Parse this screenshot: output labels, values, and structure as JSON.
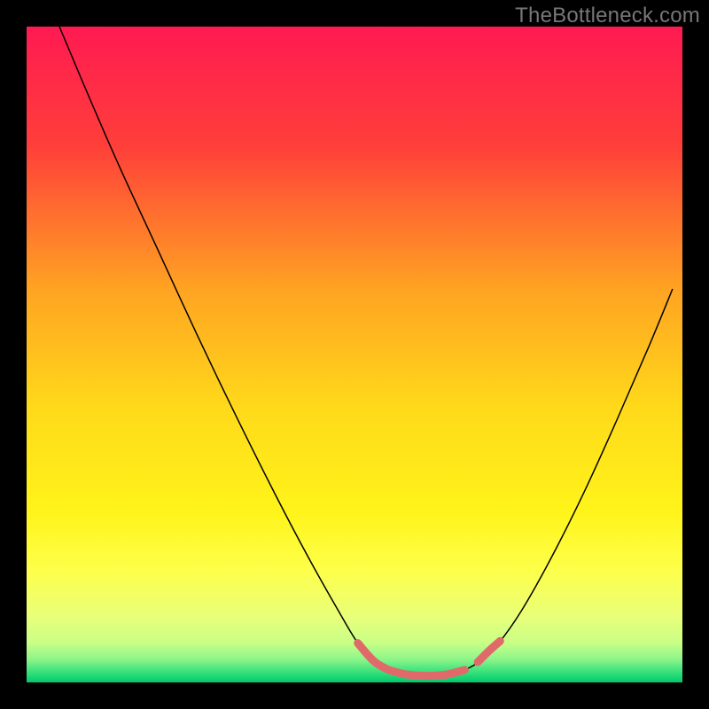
{
  "watermark": "TheBottleneck.com",
  "chart_data": {
    "type": "line",
    "title": "",
    "xlabel": "",
    "ylabel": "",
    "xlim": [
      0,
      1
    ],
    "ylim": [
      0,
      1
    ],
    "background_gradient": {
      "stops": [
        {
          "offset": 0.0,
          "color": "#ff1a52"
        },
        {
          "offset": 0.18,
          "color": "#ff3e3a"
        },
        {
          "offset": 0.4,
          "color": "#ffa322"
        },
        {
          "offset": 0.58,
          "color": "#ffd91a"
        },
        {
          "offset": 0.74,
          "color": "#fff41a"
        },
        {
          "offset": 0.83,
          "color": "#fdff4a"
        },
        {
          "offset": 0.9,
          "color": "#e9ff7a"
        },
        {
          "offset": 0.94,
          "color": "#c8ff86"
        },
        {
          "offset": 0.965,
          "color": "#8cf58a"
        },
        {
          "offset": 0.985,
          "color": "#34e07a"
        },
        {
          "offset": 1.0,
          "color": "#00c96e"
        }
      ]
    },
    "series": [
      {
        "name": "bottleneck-curve",
        "stroke": "#000000",
        "stroke_width": 1.5,
        "points": [
          {
            "x": 0.05,
            "y": 1.0
          },
          {
            "x": 0.09,
            "y": 0.905
          },
          {
            "x": 0.14,
            "y": 0.79
          },
          {
            "x": 0.2,
            "y": 0.66
          },
          {
            "x": 0.26,
            "y": 0.53
          },
          {
            "x": 0.32,
            "y": 0.405
          },
          {
            "x": 0.38,
            "y": 0.285
          },
          {
            "x": 0.43,
            "y": 0.19
          },
          {
            "x": 0.475,
            "y": 0.11
          },
          {
            "x": 0.505,
            "y": 0.06
          },
          {
            "x": 0.53,
            "y": 0.032
          },
          {
            "x": 0.555,
            "y": 0.018
          },
          {
            "x": 0.58,
            "y": 0.012
          },
          {
            "x": 0.61,
            "y": 0.01
          },
          {
            "x": 0.64,
            "y": 0.012
          },
          {
            "x": 0.67,
            "y": 0.02
          },
          {
            "x": 0.695,
            "y": 0.035
          },
          {
            "x": 0.72,
            "y": 0.06
          },
          {
            "x": 0.755,
            "y": 0.11
          },
          {
            "x": 0.8,
            "y": 0.19
          },
          {
            "x": 0.85,
            "y": 0.29
          },
          {
            "x": 0.9,
            "y": 0.4
          },
          {
            "x": 0.95,
            "y": 0.515
          },
          {
            "x": 0.985,
            "y": 0.6
          }
        ]
      },
      {
        "name": "highlight-left-descent",
        "stroke": "#e06a6a",
        "stroke_width": 9,
        "linecap": "round",
        "points": [
          {
            "x": 0.505,
            "y": 0.06
          },
          {
            "x": 0.53,
            "y": 0.032
          },
          {
            "x": 0.552,
            "y": 0.019
          }
        ]
      },
      {
        "name": "highlight-flat",
        "stroke": "#e06a6a",
        "stroke_width": 9,
        "linecap": "round",
        "points": [
          {
            "x": 0.555,
            "y": 0.018
          },
          {
            "x": 0.58,
            "y": 0.012
          },
          {
            "x": 0.61,
            "y": 0.01
          },
          {
            "x": 0.64,
            "y": 0.012
          },
          {
            "x": 0.668,
            "y": 0.019
          }
        ]
      },
      {
        "name": "highlight-right-ascent",
        "stroke": "#e06a6a",
        "stroke_width": 9,
        "linecap": "round",
        "points": [
          {
            "x": 0.688,
            "y": 0.031
          },
          {
            "x": 0.705,
            "y": 0.048
          },
          {
            "x": 0.722,
            "y": 0.063
          }
        ]
      }
    ]
  }
}
